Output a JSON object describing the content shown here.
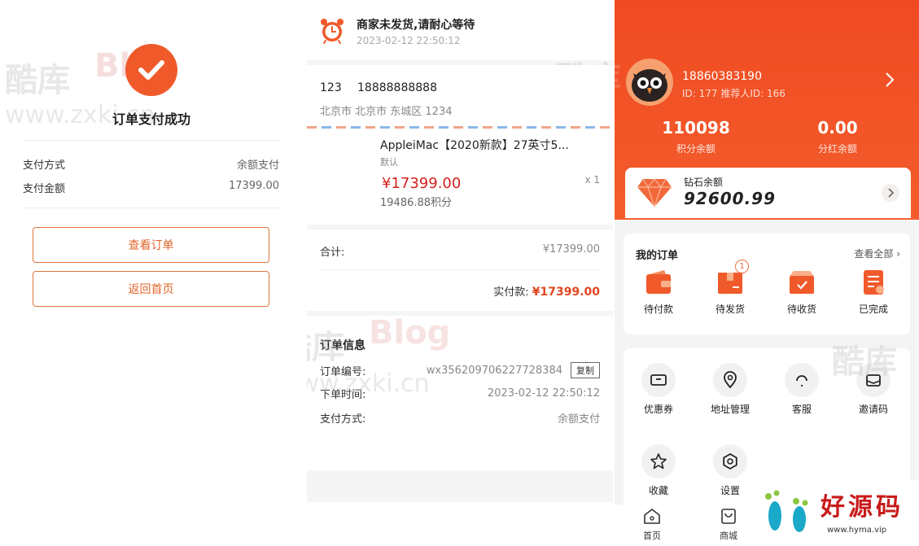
{
  "success": {
    "title": "订单支付成功",
    "rows": [
      {
        "label": "支付方式",
        "value": "余额支付"
      },
      {
        "label": "支付金额",
        "value": "17399.00"
      }
    ],
    "view_order": "查看订单",
    "back_home": "返回首页"
  },
  "watermark": {
    "cn": "酷库",
    "blog": "Blog",
    "site": "www.zxki.cn"
  },
  "order": {
    "status_title": "商家未发货,请耐心等待",
    "status_time": "2023-02-12   22:50:12",
    "addr_name": "123",
    "addr_phone": "18888888888",
    "addr_text": "北京市 北京市 东城区 1234",
    "goods_name": "AppleiMac【2020新款】27英寸5...",
    "goods_spec": "默认",
    "goods_price": "¥17399.00",
    "goods_points": "19486.88积分",
    "goods_qty": "x 1",
    "sum_label": "合计:",
    "sum_value": "¥17399.00",
    "actual_label": "实付款:",
    "actual_value": "¥17399.00",
    "info_title": "订单信息",
    "info_rows": [
      {
        "label": "订单编号:",
        "value": "wx356209706227728384"
      },
      {
        "label": "下单时间:",
        "value": "2023-02-12 22:50:12"
      },
      {
        "label": "支付方式:",
        "value": "余额支付"
      }
    ],
    "copy_label": "复制"
  },
  "profile": {
    "phone": "18860383190",
    "ids": "ID: 177   推荐人ID: 166",
    "points_value": "110098",
    "points_label": "积分余额",
    "bonus_value": "0.00",
    "bonus_label": "分红余额",
    "diamond_label": "钻石余额",
    "diamond_value": "92600.99",
    "orders_title": "我的订单",
    "orders_all": "查看全部",
    "order_items": [
      {
        "label": "待付款",
        "badge": ""
      },
      {
        "label": "待发货",
        "badge": "1"
      },
      {
        "label": "待收货",
        "badge": ""
      },
      {
        "label": "已完成",
        "badge": ""
      }
    ],
    "tools": [
      {
        "label": "优惠券"
      },
      {
        "label": "地址管理"
      },
      {
        "label": "客服"
      },
      {
        "label": "邀请码"
      },
      {
        "label": "收藏"
      },
      {
        "label": "设置"
      }
    ],
    "tabs": [
      {
        "label": "首页"
      },
      {
        "label": "商城"
      }
    ]
  },
  "brand": {
    "name": "好源码",
    "url": "www.hyma.vip"
  },
  "colors": {
    "accent": "#f05a2b",
    "price_red": "#d5211c",
    "brand_red": "#c81b1b"
  }
}
